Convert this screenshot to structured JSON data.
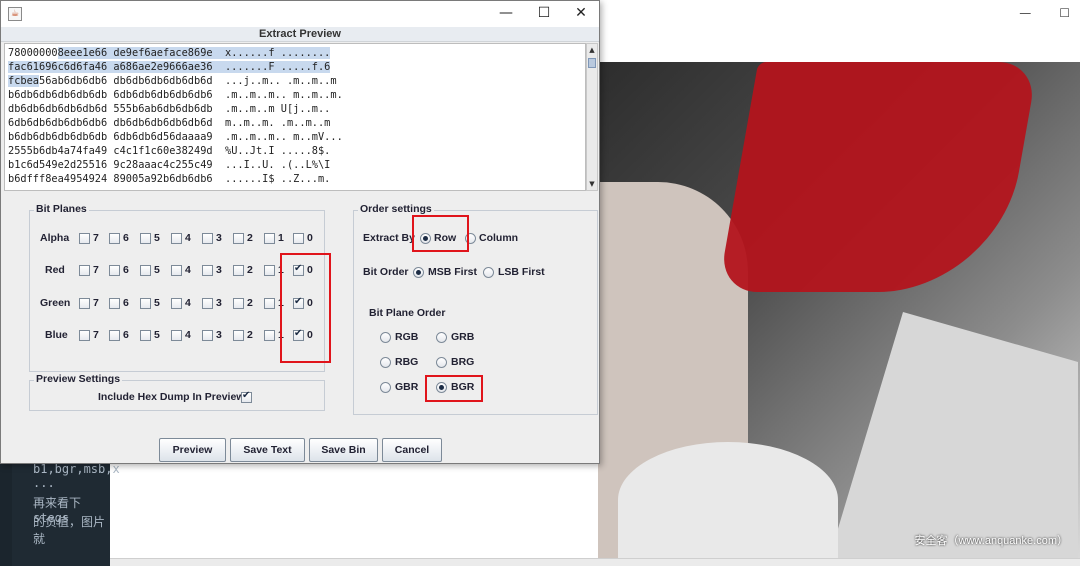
{
  "dialog": {
    "title": "Extract Preview",
    "window_controls": {
      "minimize": "—",
      "maximize": "☐",
      "close": "✕"
    },
    "hex_lines": [
      {
        "sel": "",
        "a": "78000000",
        "b": "8eee1e66 de9ef6aeface869e  x......f ........"
      },
      {
        "sel": "fac61696c6d6fa46 a686ae2e9666ae36  .......F .....f.6",
        "a": "",
        "b": ""
      },
      {
        "sel": "fcbea",
        "a": "",
        "b": "56ab6db6db6 db6db6db6db6db6d  ...j..m.. .m..m..m"
      },
      {
        "sel": "",
        "a": "b6db6db6db6db6db",
        "b": " 6db6db6db6db6db6  .m..m..m.. m..m..m."
      },
      {
        "sel": "",
        "a": "db6db6db6db6db6d",
        "b": " 555b6ab6db6db6db  .m..m..m U[j..m.."
      },
      {
        "sel": "",
        "a": "6db6db6db6db6db6",
        "b": " db6db6db6db6db6d  m..m..m. .m..m..m"
      },
      {
        "sel": "",
        "a": "b6db6db6db6db6db",
        "b": " 6db6db6d56daaaa9  .m..m..m.. m..mV..."
      },
      {
        "sel": "",
        "a": "2555b6db4a74fa49",
        "b": " c4c1f1c60e38249d  %U..Jt.I .....8$."
      },
      {
        "sel": "",
        "a": "b1c6d549e2d25516",
        "b": " 9c28aaac4c255c49  ...I..U. .(..L%\\I"
      },
      {
        "sel": "",
        "a": "b6dfff8ea4954924",
        "b": " 89005a92b6db6db6  ......I$ ..Z...m."
      }
    ],
    "bit_planes": {
      "title": "Bit Planes",
      "bits": [
        "7",
        "6",
        "5",
        "4",
        "3",
        "2",
        "1",
        "0"
      ],
      "channels": [
        {
          "name": "Alpha",
          "checked": [
            false,
            false,
            false,
            false,
            false,
            false,
            false,
            false
          ]
        },
        {
          "name": "Red",
          "checked": [
            false,
            false,
            false,
            false,
            false,
            false,
            false,
            true
          ]
        },
        {
          "name": "Green",
          "checked": [
            false,
            false,
            false,
            false,
            false,
            false,
            false,
            true
          ]
        },
        {
          "name": "Blue",
          "checked": [
            false,
            false,
            false,
            false,
            false,
            false,
            false,
            true
          ]
        }
      ]
    },
    "preview_settings": {
      "title": "Preview Settings",
      "hex_dump_label": "Include Hex Dump In Preview",
      "hex_dump_checked": true
    },
    "order_settings": {
      "title": "Order settings",
      "extract_by_label": "Extract By",
      "extract_by_options": [
        "Row",
        "Column"
      ],
      "extract_by_selected": "Row",
      "bit_order_label": "Bit Order",
      "bit_order_options": [
        "MSB First",
        "LSB First"
      ],
      "bit_order_selected": "MSB First",
      "plane_order_label": "Bit Plane Order",
      "plane_order_options": [
        "RGB",
        "GRB",
        "RBG",
        "BRG",
        "GBR",
        "BGR"
      ],
      "plane_order_selected": "BGR"
    },
    "buttons": {
      "preview": "Preview",
      "save_text": "Save Text",
      "save_bin": "Save Bin",
      "cancel": "Cancel"
    }
  },
  "background": {
    "editor_lines": [
      "b1,bgr,msb,x",
      "...",
      "再来看下stegs",
      "的负值，图片就"
    ],
    "viewer_controls": {
      "minimize": "—",
      "maximize": "☐"
    },
    "watermark": "安全客（www.anquanke.com）"
  },
  "colors": {
    "highlight": "#e0141b",
    "selection": "#c8d9ee"
  }
}
